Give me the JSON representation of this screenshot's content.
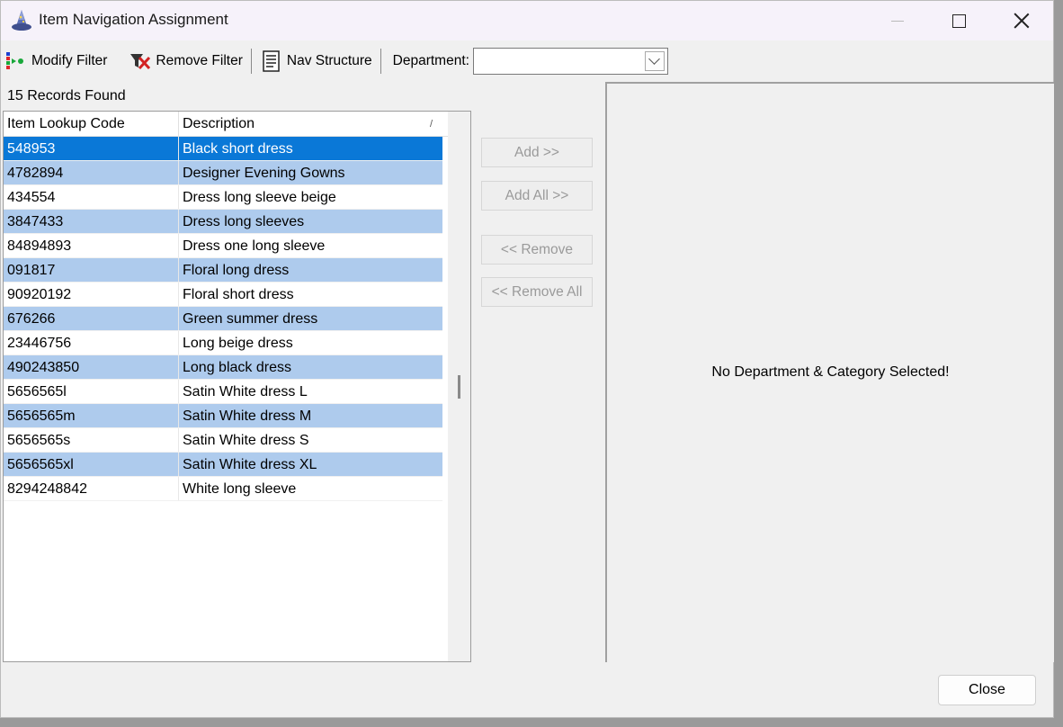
{
  "window": {
    "title": "Item Navigation Assignment"
  },
  "toolbar": {
    "modify_filter": "Modify Filter",
    "remove_filter": "Remove Filter",
    "nav_structure": "Nav Structure",
    "department_label": "Department:",
    "department_value": ""
  },
  "records_label": "15 Records Found",
  "grid": {
    "columns": [
      "Item Lookup Code",
      "Description"
    ],
    "sort_indicator": "/",
    "rows": [
      {
        "code": "548953",
        "description": "Black short dress"
      },
      {
        "code": "4782894",
        "description": "Designer Evening Gowns"
      },
      {
        "code": "434554",
        "description": "Dress long sleeve beige"
      },
      {
        "code": "3847433",
        "description": "Dress long sleeves"
      },
      {
        "code": "84894893",
        "description": "Dress one long sleeve"
      },
      {
        "code": "091817",
        "description": "Floral long dress"
      },
      {
        "code": "90920192",
        "description": "Floral short dress"
      },
      {
        "code": "676266",
        "description": "Green summer dress"
      },
      {
        "code": "23446756",
        "description": "Long beige dress"
      },
      {
        "code": "490243850",
        "description": "Long black dress"
      },
      {
        "code": "5656565l",
        "description": "Satin White dress L"
      },
      {
        "code": "5656565m",
        "description": "Satin White dress M"
      },
      {
        "code": "5656565s",
        "description": "Satin White dress S"
      },
      {
        "code": "5656565xl",
        "description": "Satin White dress XL"
      },
      {
        "code": "8294248842",
        "description": "White long sleeve"
      }
    ],
    "selected_row": 0
  },
  "actions": {
    "add": "Add >>",
    "add_all": "Add All >>",
    "remove": "<< Remove",
    "remove_all": "<< Remove All"
  },
  "right_panel": {
    "message": "No Department & Category Selected!"
  },
  "footer": {
    "close": "Close"
  },
  "colors": {
    "selected_row": "#0a78d7",
    "alt_row": "#aecbed"
  }
}
